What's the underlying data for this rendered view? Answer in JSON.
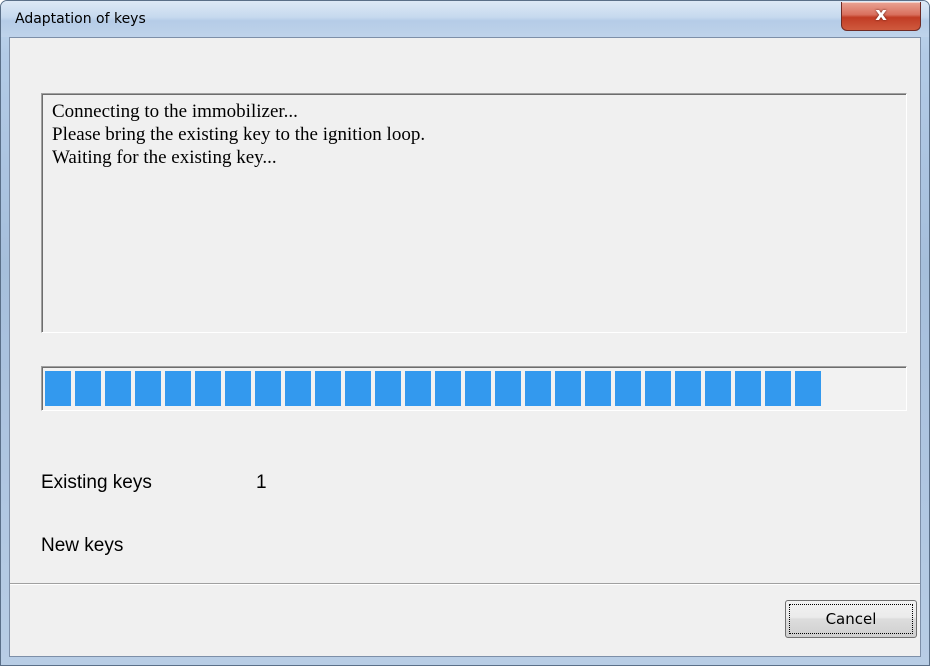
{
  "window": {
    "title": "Adaptation of keys",
    "close_glyph": "x"
  },
  "log": {
    "lines": [
      "Connecting to the immobilizer...",
      "Please bring the existing key to the ignition loop.",
      "Waiting for the existing key..."
    ]
  },
  "progress": {
    "fraction": 0.905,
    "color": "#3399ee"
  },
  "keys": {
    "existing_label": "Existing keys",
    "existing_value": "1",
    "new_label": "New keys"
  },
  "buttons": {
    "cancel_label": "Cancel"
  }
}
